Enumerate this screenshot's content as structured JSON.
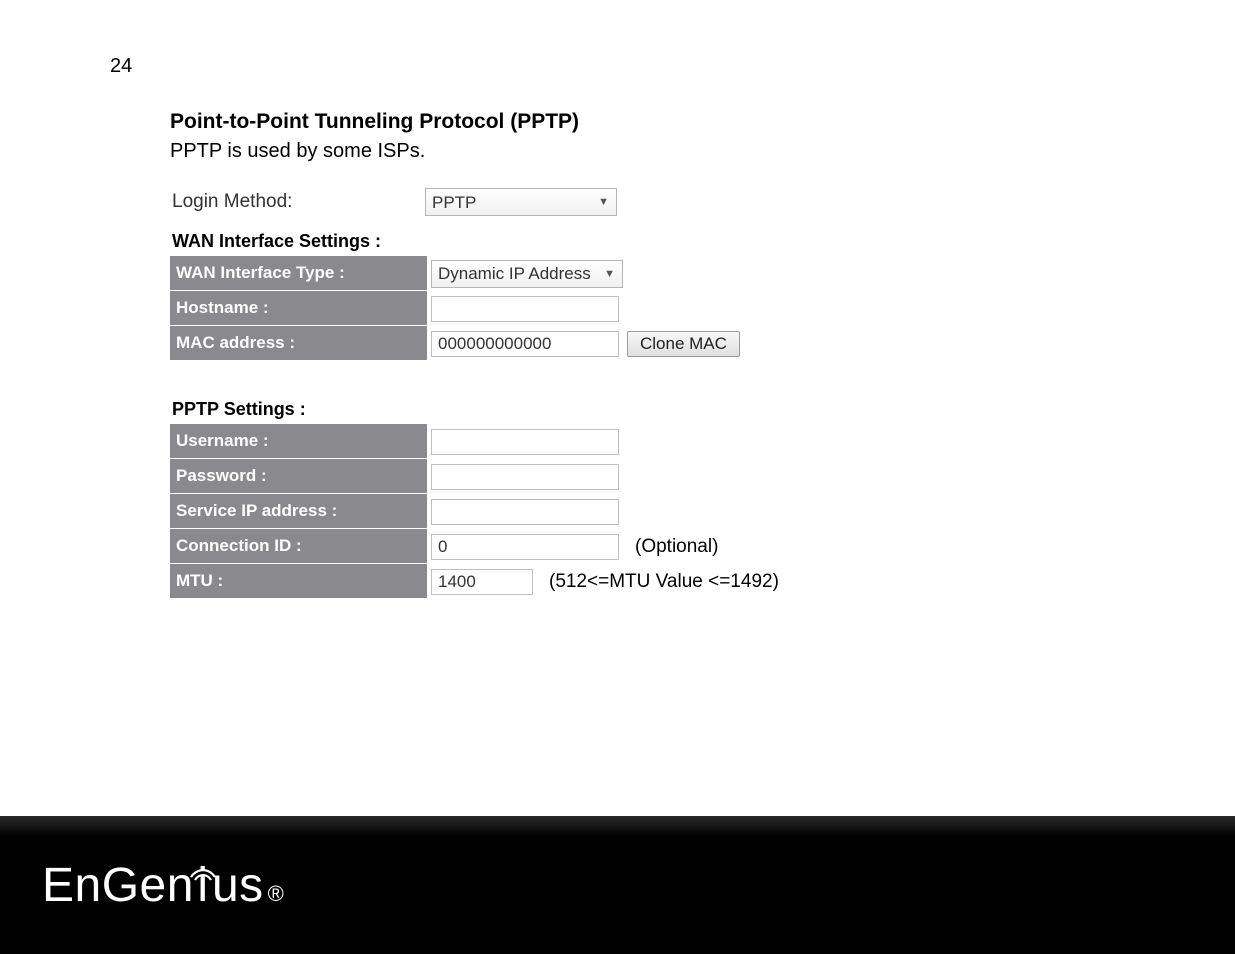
{
  "page_number": "24",
  "title": "Point-to-Point Tunneling Protocol (PPTP)",
  "subtitle": "PPTP is used by some ISPs.",
  "login_method": {
    "label": "Login Method:",
    "value": "PPTP"
  },
  "wan_section_title": "WAN Interface Settings :",
  "wan": {
    "interface_type_label": "WAN Interface Type :",
    "interface_type_value": "Dynamic IP Address",
    "hostname_label": "Hostname :",
    "hostname_value": "",
    "mac_label": "MAC address :",
    "mac_value": "000000000000",
    "clone_mac_button": "Clone MAC"
  },
  "pptp_section_title": "PPTP Settings :",
  "pptp": {
    "username_label": "Username :",
    "username_value": "",
    "password_label": "Password :",
    "password_value": "",
    "service_ip_label": "Service IP address :",
    "service_ip_value": "",
    "connection_id_label": "Connection ID :",
    "connection_id_value": "0",
    "connection_id_hint": "(Optional)",
    "mtu_label": "MTU :",
    "mtu_value": "1400",
    "mtu_hint": "(512<=MTU Value <=1492)"
  },
  "logo": {
    "text_en": "En",
    "text_gen": "Gen",
    "text_i": "i",
    "text_us": "us",
    "reg": "®"
  }
}
